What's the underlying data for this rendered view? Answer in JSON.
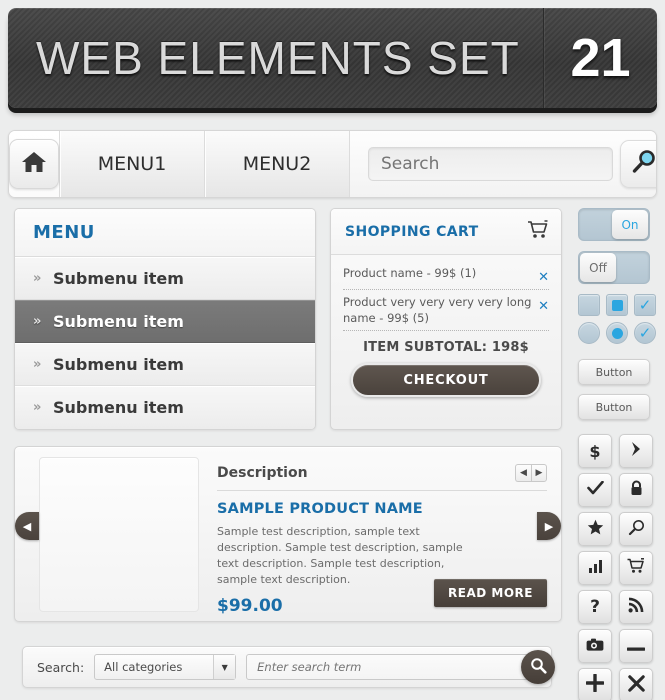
{
  "banner": {
    "title": "WEB ELEMENTS SET",
    "number": "21"
  },
  "nav": {
    "home_icon": "home-icon",
    "items": [
      {
        "label": "MENU1"
      },
      {
        "label": "MENU2"
      }
    ],
    "search_placeholder": "Search",
    "search_value": "",
    "search_icon": "magnifier-icon"
  },
  "menu": {
    "title": "MENU",
    "bullet": "»",
    "items": [
      {
        "label": "Submenu item",
        "active": false
      },
      {
        "label": "Submenu item",
        "active": true
      },
      {
        "label": "Submenu item",
        "active": false
      },
      {
        "label": "Submenu item",
        "active": false
      }
    ]
  },
  "cart": {
    "title": "SHOPPING CART",
    "cart_icon": "shopping-cart-icon",
    "items": [
      {
        "name": "Product name - 99$ (1)",
        "remove": "✕"
      },
      {
        "name": "Product very very very very long name - 99$ (5)",
        "remove": "✕"
      }
    ],
    "subtotal": "ITEM SUBTOTAL: 198$",
    "checkout_label": "CHECKOUT"
  },
  "rail": {
    "toggle_on_label": "On",
    "toggle_off_label": "Off",
    "button1_label": "Button",
    "button2_label": "Button",
    "accent_blue": "#2ba6e0",
    "control_bg": "#b9cdd8",
    "icons": [
      "dollar-icon",
      "chevron-right-icon",
      "check-icon",
      "lock-icon",
      "star-icon",
      "search-icon",
      "bar-chart-icon",
      "shopping-cart-icon",
      "question-icon",
      "rss-icon",
      "camera-icon",
      "minus-icon",
      "plus-icon",
      "close-icon"
    ]
  },
  "product": {
    "desc_title": "Description",
    "prev_page": "◀",
    "next_page": "▶",
    "name": "SAMPLE PRODUCT NAME",
    "description": "Sample test description, sample text description. Sample test description, sample text description. Sample test description, sample text description.",
    "price": "$99.00",
    "read_more_label": "READ MORE",
    "carousel_prev": "◀",
    "carousel_next": "▶"
  },
  "bottom_search": {
    "label": "Search:",
    "category_value": "All categories",
    "caret": "▼",
    "input_placeholder": "Enter search term",
    "input_value": "",
    "go_icon": "magnifier-icon"
  },
  "theme": {
    "accent_blue": "#1a6ea8",
    "bright_blue": "#2ba6e0",
    "dark_brown": "#4a423c",
    "page_bg": "#eceded"
  }
}
